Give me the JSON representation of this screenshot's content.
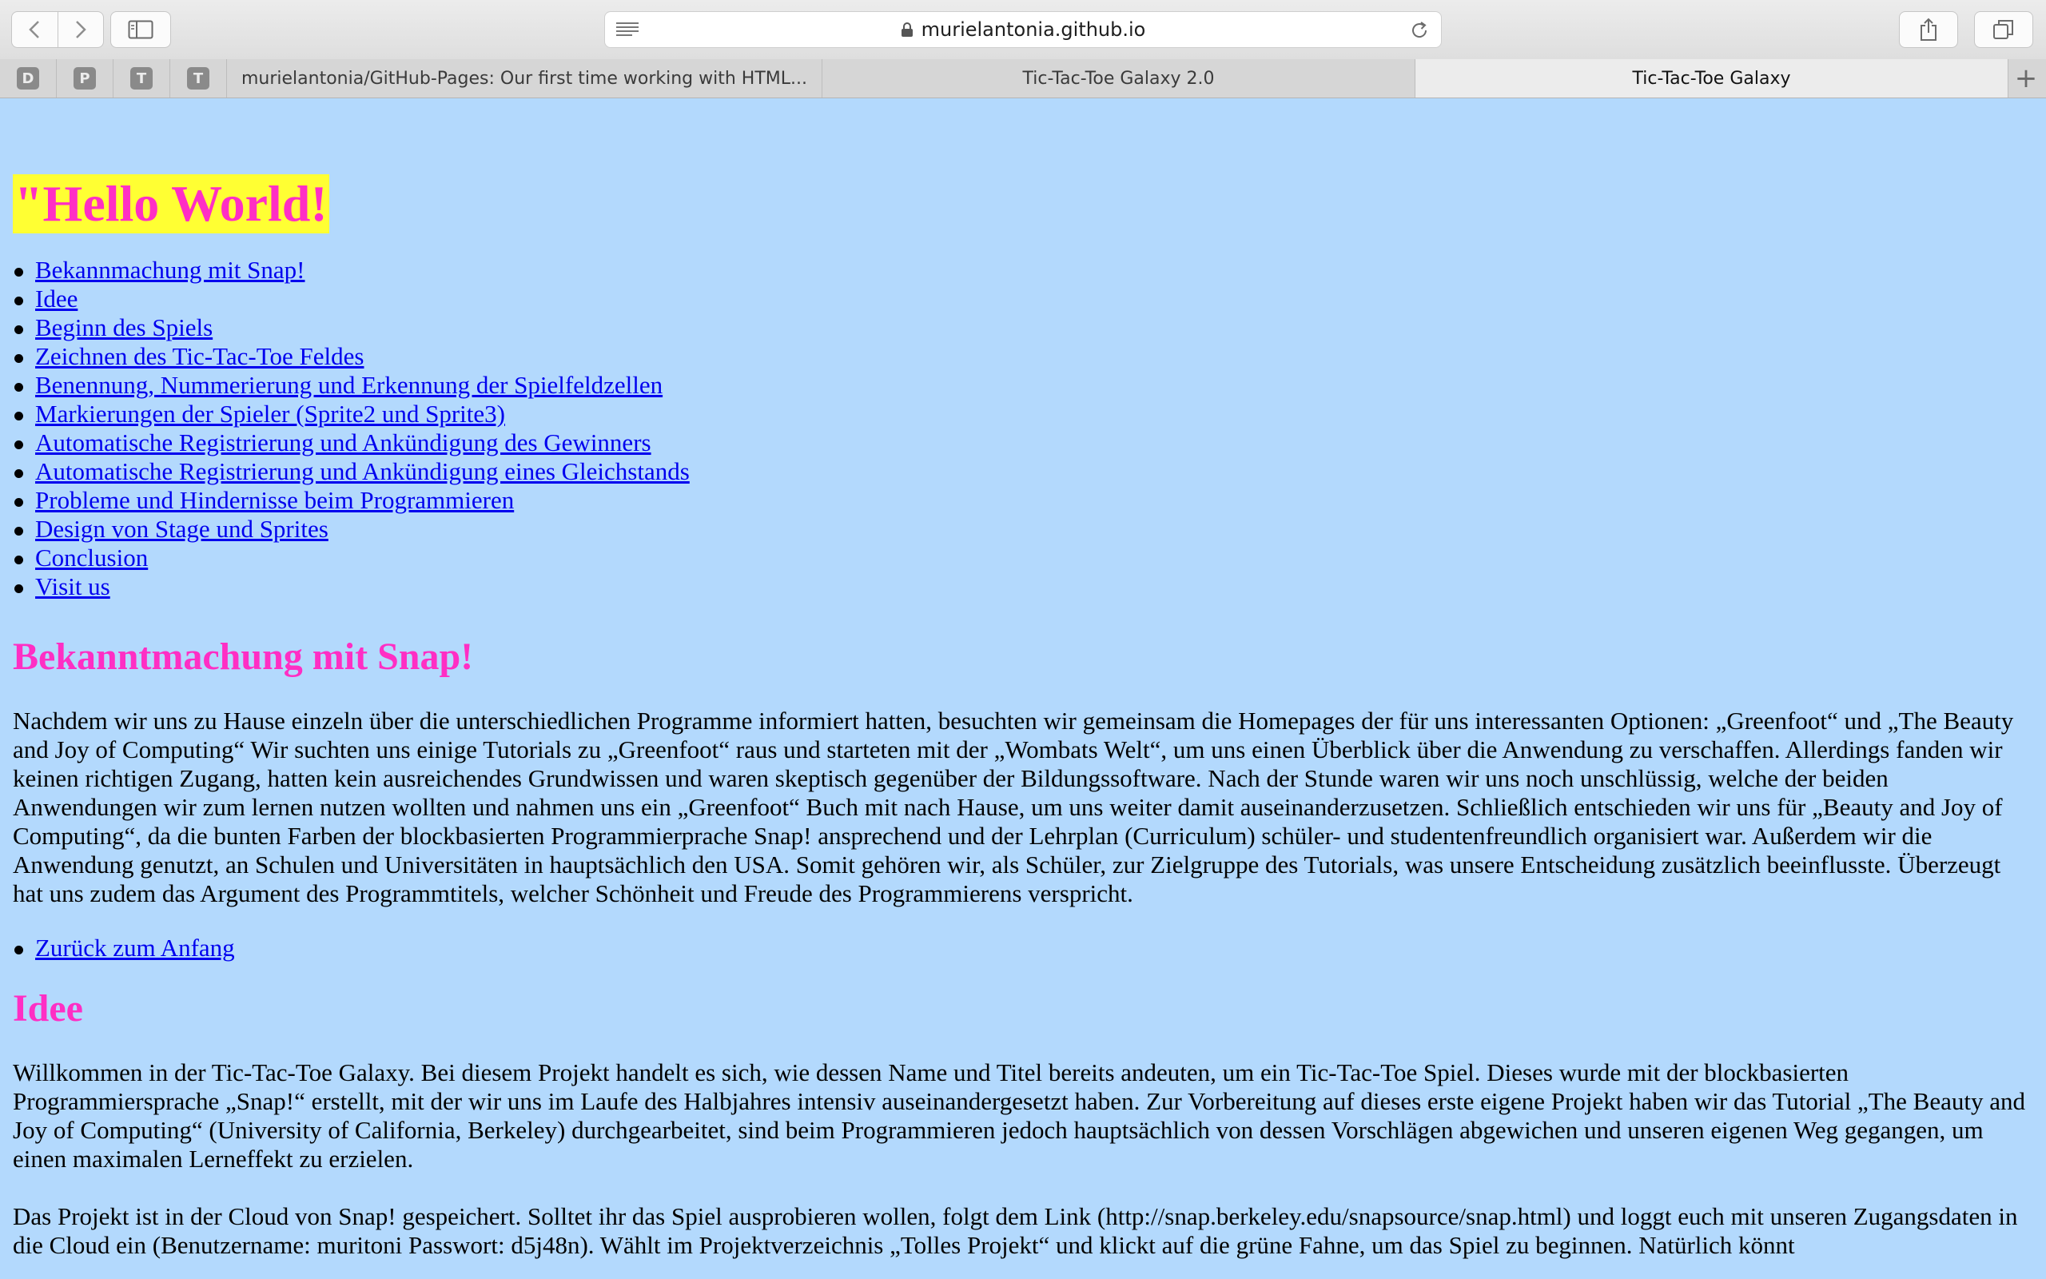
{
  "browser": {
    "url": "murielantonia.github.io",
    "pinned_tabs": [
      "D",
      "P",
      "T",
      "T"
    ],
    "tabs": [
      {
        "title": "murielantonia/GitHub-Pages: Our first time working with HTML..."
      },
      {
        "title": "Tic-Tac-Toe Galaxy 2.0"
      },
      {
        "title": "Tic-Tac-Toe Galaxy"
      }
    ],
    "new_tab_label": "+",
    "icons": [
      "back-icon",
      "forward-icon",
      "sidebar-icon",
      "reader-icon",
      "lock-icon",
      "reload-icon",
      "share-icon",
      "tabs-overview-icon"
    ]
  },
  "page": {
    "title": "\"Hello World!",
    "toc": [
      "Bekannmachung mit Snap!",
      "Idee",
      "Beginn des Spiels",
      "Zeichnen des Tic-Tac-Toe Feldes",
      "Benennung, Nummerierung und Erkennung der Spielfeldzellen",
      "Markierungen der Spieler (Sprite2 und Sprite3)",
      "Automatische Registrierung und Ankündigung des Gewinners",
      "Automatische Registrierung und Ankündigung eines Gleichstands",
      "Probleme und Hindernisse beim Programmieren",
      "Design von Stage und Sprites",
      "Conclusion",
      "Visit us"
    ],
    "section1": {
      "heading": "Bekanntmachung mit Snap!",
      "text": "Nachdem wir uns zu Hause einzeln über die unterschiedlichen Programme informiert hatten, besuchten wir gemeinsam die Homepages der für uns interessanten Optionen: „Greenfoot“ und „The Beauty and Joy of Computing“ Wir suchten uns einige Tutorials zu „Greenfoot“ raus und starteten mit der „Wombats Welt“, um uns einen Überblick über die Anwendung zu verschaffen. Allerdings fanden wir keinen richtigen Zugang, hatten kein ausreichendes Grundwissen und waren skeptisch gegenüber der Bildungssoftware. Nach der Stunde waren wir uns noch unschlüssig, welche der beiden Anwendungen wir zum lernen nutzen wollten und nahmen uns ein „Greenfoot“ Buch mit nach Hause, um uns weiter damit auseinanderzusetzen. Schließlich entschieden wir uns für „Beauty and Joy of Computing“, da die bunten Farben der blockbasierten Programmierprache Snap! ansprechend und der Lehrplan (Curriculum) schüler- und studentenfreundlich organisiert war. Außerdem wir die Anwendung genutzt, an Schulen und Universitäten in hauptsächlich den USA. Somit gehören wir, als Schüler, zur Zielgruppe des Tutorials, was unsere Entscheidung zusätzlich beeinflusste. Überzeugt hat uns zudem das Argument des Programmtitels, welcher Schönheit und Freude des Programmierens verspricht.",
      "back_link": "Zurück zum Anfang"
    },
    "section2": {
      "heading": "Idee",
      "text1": "Willkommen in der Tic-Tac-Toe Galaxy. Bei diesem Projekt handelt es sich, wie dessen Name und Titel bereits andeuten, um ein Tic-Tac-Toe Spiel. Dieses wurde mit der blockbasierten Programmiersprache „Snap!“ erstellt, mit der wir uns im Laufe des Halbjahres intensiv auseinandergesetzt haben. Zur Vorbereitung auf dieses erste eigene Projekt haben wir das Tutorial „The Beauty and Joy of Computing“ (University of California, Berkeley) durchgearbeitet, sind beim Programmieren jedoch hauptsächlich von dessen Vorschlägen abgewichen und unseren eigenen Weg gegangen, um einen maximalen Lerneffekt zu erzielen.",
      "text2": "Das Projekt ist in der Cloud von Snap! gespeichert. Solltet ihr das Spiel ausprobieren wollen, folgt  dem Link (http://snap.berkeley.edu/snapsource/snap.html) und loggt euch mit unseren Zugangsdaten in die Cloud ein (Benutzername: muritoni Passwort: d5j48n). Wählt im Projektverzeichnis „Tolles Projekt“ und klickt auf die grüne Fahne, um das Spiel zu beginnen. Natürlich könnt"
    },
    "colors": {
      "background": "#b3d9fd",
      "heading": "#ff2ec4",
      "title_highlight": "#ffff33",
      "link": "#0000ee"
    }
  }
}
